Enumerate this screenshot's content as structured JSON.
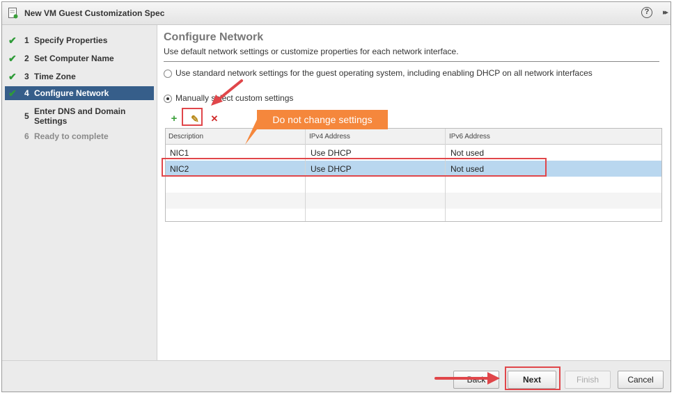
{
  "window": {
    "title": "New VM Guest Customization Spec",
    "help_label": "?",
    "expand_label": "▸▸"
  },
  "sidebar": {
    "steps": [
      {
        "num": "1",
        "label": "Specify Properties",
        "state": "done"
      },
      {
        "num": "2",
        "label": "Set Computer Name",
        "state": "done"
      },
      {
        "num": "3",
        "label": "Time Zone",
        "state": "done"
      },
      {
        "num": "4",
        "label": "Configure Network",
        "state": "active"
      },
      {
        "num": "5",
        "label": "Enter DNS and Domain Settings",
        "state": "pending"
      },
      {
        "num": "6",
        "label": "Ready to complete",
        "state": "disabled"
      }
    ],
    "check_glyph": "✔"
  },
  "main": {
    "title": "Configure Network",
    "description": "Use default network settings or customize properties for each network interface.",
    "options": [
      {
        "label": "Use standard network settings for the guest operating system, including enabling DHCP on all network interfaces",
        "selected": false
      },
      {
        "label": "Manually select custom settings",
        "selected": true
      }
    ],
    "toolbar": {
      "add_icon": "+",
      "edit_icon": "✎",
      "remove_icon": "✕"
    },
    "grid": {
      "columns": [
        "Description",
        "IPv4 Address",
        "IPv6 Address"
      ],
      "rows": [
        [
          "NIC1",
          "Use DHCP",
          "Not used"
        ],
        [
          "NIC2",
          "Use DHCP",
          "Not used"
        ]
      ],
      "selected_row": 1
    }
  },
  "annotation": {
    "callout_text": "Do not change settings"
  },
  "footer": {
    "back_label": "Back",
    "next_label": "Next",
    "finish_label": "Finish",
    "cancel_label": "Cancel"
  },
  "colors": {
    "active_step": "#365e8a",
    "selected_row": "#b9d7ef",
    "annotation_red": "#e0464a",
    "callout_orange": "#f5873c",
    "check_green": "#2e9b38"
  }
}
